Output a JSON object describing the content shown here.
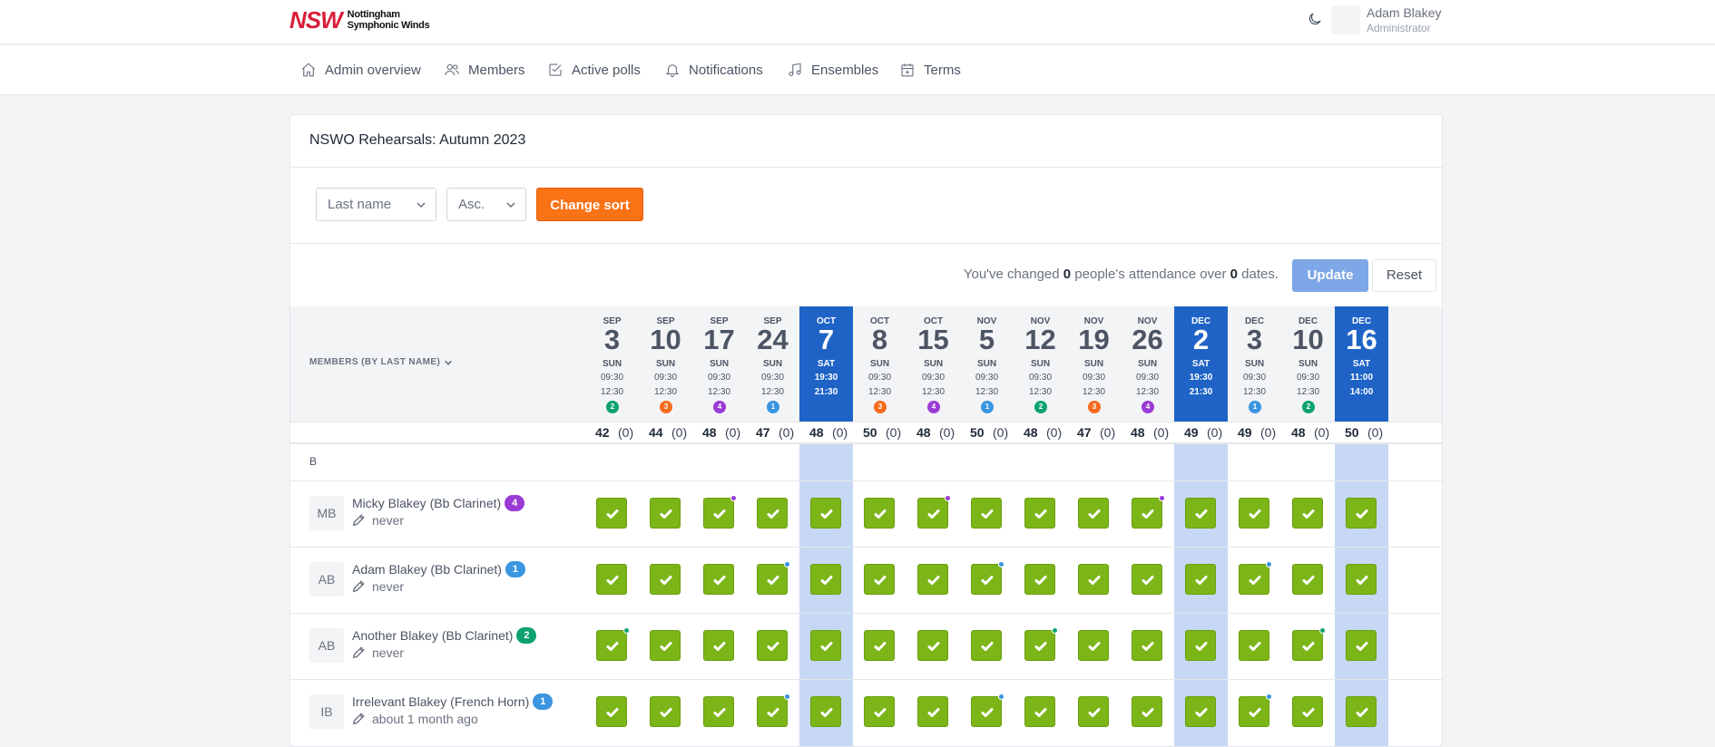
{
  "header": {
    "logo_mark": "NSW",
    "logo_line1": "Nottingham",
    "logo_line2": "Symphonic Winds",
    "theme_icon": "moon-icon",
    "user_name": "Adam Blakey",
    "user_role": "Administrator"
  },
  "nav": [
    {
      "label": "Admin overview",
      "icon": "home-icon"
    },
    {
      "label": "Members",
      "icon": "users-icon"
    },
    {
      "label": "Active polls",
      "icon": "checkbox-icon"
    },
    {
      "label": "Notifications",
      "icon": "bell-icon"
    },
    {
      "label": "Ensembles",
      "icon": "music-note-icon"
    },
    {
      "label": "Terms",
      "icon": "calendar-icon"
    }
  ],
  "page": {
    "title": "NSWO Rehearsals: Autumn 2023",
    "sort_field": "Last name",
    "sort_order": "Asc.",
    "change_sort_label": "Change sort",
    "changed_prefix": "You've changed ",
    "changed_people": "0",
    "changed_mid": " people's attendance over ",
    "changed_dates": "0",
    "changed_suffix": " dates.",
    "update_label": "Update",
    "reset_label": "Reset",
    "members_header": "MEMBERS (BY LAST NAME)",
    "group_label": "B"
  },
  "colors": {
    "term1": "#3b95e0",
    "term2": "#0ea271",
    "term3": "#f56b1d",
    "term4": "#9b3bd6",
    "highlight": "#1f63c6",
    "check": "#7cb518"
  },
  "dates": [
    {
      "mon": "SEP",
      "day": "3",
      "dow": "SUN",
      "t1": "09:30",
      "t2": "12:30",
      "term": "2",
      "hl": false,
      "total": "42",
      "changed": "(0)"
    },
    {
      "mon": "SEP",
      "day": "10",
      "dow": "SUN",
      "t1": "09:30",
      "t2": "12:30",
      "term": "3",
      "hl": false,
      "total": "44",
      "changed": "(0)"
    },
    {
      "mon": "SEP",
      "day": "17",
      "dow": "SUN",
      "t1": "09:30",
      "t2": "12:30",
      "term": "4",
      "hl": false,
      "total": "48",
      "changed": "(0)"
    },
    {
      "mon": "SEP",
      "day": "24",
      "dow": "SUN",
      "t1": "09:30",
      "t2": "12:30",
      "term": "1",
      "hl": false,
      "total": "47",
      "changed": "(0)"
    },
    {
      "mon": "OCT",
      "day": "7",
      "dow": "SAT",
      "t1": "19:30",
      "t2": "21:30",
      "term": "",
      "hl": true,
      "total": "48",
      "changed": "(0)"
    },
    {
      "mon": "OCT",
      "day": "8",
      "dow": "SUN",
      "t1": "09:30",
      "t2": "12:30",
      "term": "3",
      "hl": false,
      "total": "50",
      "changed": "(0)"
    },
    {
      "mon": "OCT",
      "day": "15",
      "dow": "SUN",
      "t1": "09:30",
      "t2": "12:30",
      "term": "4",
      "hl": false,
      "total": "48",
      "changed": "(0)"
    },
    {
      "mon": "NOV",
      "day": "5",
      "dow": "SUN",
      "t1": "09:30",
      "t2": "12:30",
      "term": "1",
      "hl": false,
      "total": "50",
      "changed": "(0)"
    },
    {
      "mon": "NOV",
      "day": "12",
      "dow": "SUN",
      "t1": "09:30",
      "t2": "12:30",
      "term": "2",
      "hl": false,
      "total": "48",
      "changed": "(0)"
    },
    {
      "mon": "NOV",
      "day": "19",
      "dow": "SUN",
      "t1": "09:30",
      "t2": "12:30",
      "term": "3",
      "hl": false,
      "total": "47",
      "changed": "(0)"
    },
    {
      "mon": "NOV",
      "day": "26",
      "dow": "SUN",
      "t1": "09:30",
      "t2": "12:30",
      "term": "4",
      "hl": false,
      "total": "48",
      "changed": "(0)"
    },
    {
      "mon": "DEC",
      "day": "2",
      "dow": "SAT",
      "t1": "19:30",
      "t2": "21:30",
      "term": "",
      "hl": true,
      "total": "49",
      "changed": "(0)"
    },
    {
      "mon": "DEC",
      "day": "3",
      "dow": "SUN",
      "t1": "09:30",
      "t2": "12:30",
      "term": "1",
      "hl": false,
      "total": "49",
      "changed": "(0)"
    },
    {
      "mon": "DEC",
      "day": "10",
      "dow": "SUN",
      "t1": "09:30",
      "t2": "12:30",
      "term": "2",
      "hl": false,
      "total": "48",
      "changed": "(0)"
    },
    {
      "mon": "DEC",
      "day": "16",
      "dow": "SAT",
      "t1": "11:00",
      "t2": "14:00",
      "term": "",
      "hl": true,
      "total": "50",
      "changed": "(0)"
    }
  ],
  "members": [
    {
      "initials": "MB",
      "name": "Micky Blakey (Bb Clarinet)",
      "term": "4",
      "edited": "never"
    },
    {
      "initials": "AB",
      "name": "Adam Blakey (Bb Clarinet)",
      "term": "1",
      "edited": "never"
    },
    {
      "initials": "AB",
      "name": "Another Blakey (Bb Clarinet)",
      "term": "2",
      "edited": "never"
    },
    {
      "initials": "IB",
      "name": "Irrelevant Blakey (French Horn)",
      "term": "1",
      "edited": "about 1 month ago"
    }
  ]
}
